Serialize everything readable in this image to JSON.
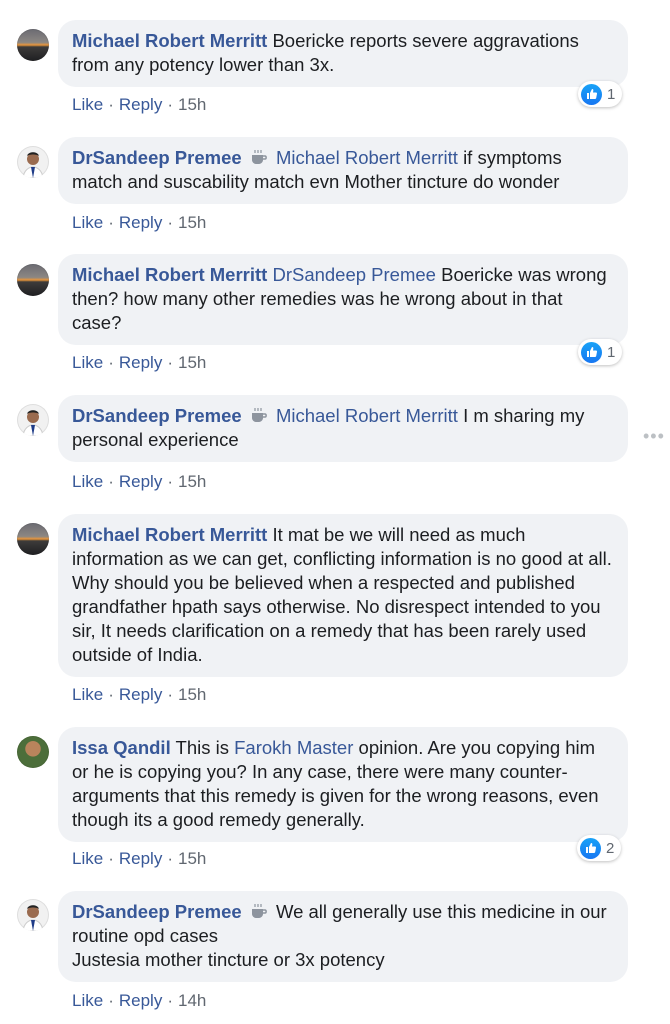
{
  "comments": [
    {
      "author": "Michael Robert Merritt",
      "mention": "",
      "text": "Boericke reports severe aggravations from any potency lower than 3x.",
      "actions": {
        "like": "Like",
        "reply": "Reply",
        "time": "15h"
      },
      "reactions": "1"
    },
    {
      "author": "DrSandeep Premee",
      "mention": "Michael Robert Merritt",
      "text": "if symptoms match and suscability match evn Mother tincture do wonder",
      "actions": {
        "like": "Like",
        "reply": "Reply",
        "time": "15h"
      }
    },
    {
      "author": "Michael Robert Merritt",
      "mention": "DrSandeep Premee",
      "text": "Boericke was wrong then? how many other remedies was he wrong about in that case?",
      "actions": {
        "like": "Like",
        "reply": "Reply",
        "time": "15h"
      },
      "reactions": "1"
    },
    {
      "author": "DrSandeep Premee",
      "mention": "Michael Robert Merritt",
      "text": "I m sharing my personal experience",
      "actions": {
        "like": "Like",
        "reply": "Reply",
        "time": "15h"
      }
    },
    {
      "author": "Michael Robert Merritt",
      "mention": "",
      "text": "It mat be we will need as much information as we can get, conflicting information is no good at all. Why should you be believed when a respected and published grandfather hpath says otherwise. No disrespect intended to you sir, It needs clarification on a remedy that has been rarely used outside of India.",
      "actions": {
        "like": "Like",
        "reply": "Reply",
        "time": "15h"
      }
    },
    {
      "author": "Issa Qandil",
      "text_before": "This is",
      "mention": "Farokh Master",
      "text": "opinion. Are you copying him or he is copying you? In any case, there were many counter-arguments that this remedy is given for the wrong reasons, even though its a good remedy generally.",
      "actions": {
        "like": "Like",
        "reply": "Reply",
        "time": "15h"
      },
      "reactions": "2"
    },
    {
      "author": "DrSandeep Premee",
      "mention": "",
      "text": "We all generally use this medicine in our routine opd cases",
      "text_line2": "Justesia mother tincture or 3x potency",
      "actions": {
        "like": "Like",
        "reply": "Reply",
        "time": "14h"
      }
    }
  ],
  "colors": {
    "link": "#385898",
    "bubble": "#f0f2f5",
    "text": "#1c1e21",
    "meta": "#606770",
    "like": "#1877f2"
  },
  "icons": {
    "more": "more-options-icon",
    "reaction": "thumbs-up-icon",
    "badge": "coffee-cup-icon"
  }
}
